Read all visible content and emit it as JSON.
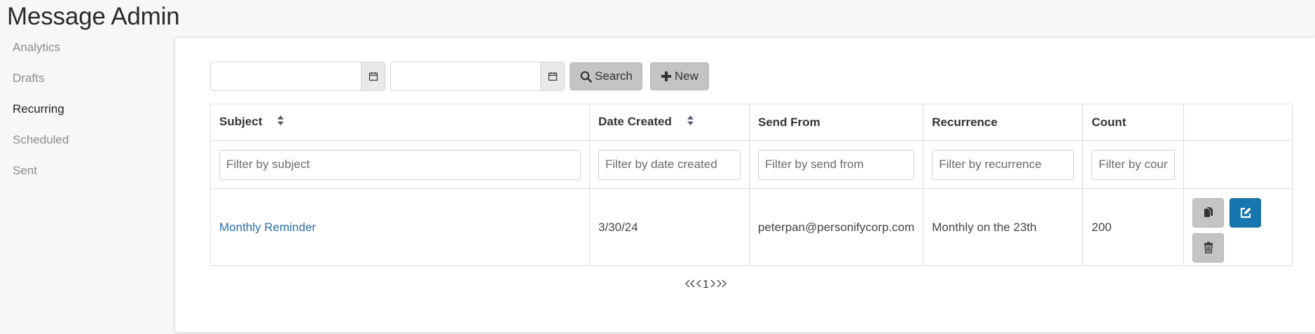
{
  "app": {
    "title": "Message Admin"
  },
  "sidebar": {
    "items": [
      {
        "label": "Analytics",
        "active": false
      },
      {
        "label": "Drafts",
        "active": false
      },
      {
        "label": "Recurring",
        "active": true
      },
      {
        "label": "Scheduled",
        "active": false
      },
      {
        "label": "Sent",
        "active": false
      }
    ]
  },
  "toolbar": {
    "start_date": "",
    "end_date": "",
    "search_label": "Search",
    "new_label": "New"
  },
  "table": {
    "columns": [
      "Subject",
      "Date Created",
      "Send From",
      "Recurrence",
      "Count"
    ],
    "filters": {
      "subject": "Filter by subject",
      "date_created": "Filter by date created",
      "send_from": "Filter by send from",
      "recurrence": "Filter by recurrence",
      "count": "Filter by count"
    },
    "rows": [
      {
        "subject": "Monthly Reminder",
        "date_created": "3/30/24",
        "send_from": "peterpan@personifycorp.com",
        "recurrence": "Monthly on the 23th",
        "count": "200"
      }
    ]
  },
  "pagination": {
    "first": "«",
    "prev": "‹",
    "current": "1",
    "next": "›",
    "last": "»"
  },
  "colors": {
    "accent": "#1676b0",
    "link": "#2a6fa8",
    "page_active": "#add0e3",
    "button_gray": "#c4c4c4"
  }
}
